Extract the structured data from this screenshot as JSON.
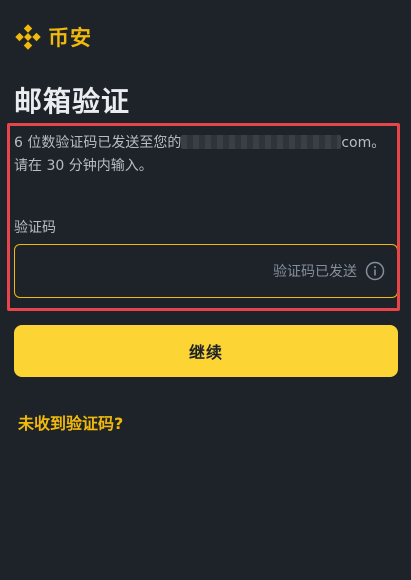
{
  "brand": {
    "name": "币安",
    "color": "#f0b90b"
  },
  "title": "邮箱验证",
  "description": {
    "line1_prefix": "6 位数验证码已发送至您的",
    "line1_suffix": "com。",
    "line2": "请在 30 分钟内输入。"
  },
  "code_field": {
    "label": "验证码",
    "value": "",
    "placeholder": "",
    "status_text": "验证码已发送",
    "icon": "info-icon"
  },
  "continue_button": {
    "label": "继续",
    "color": "#fcd535"
  },
  "resend_link": {
    "label": "未收到验证码?"
  },
  "highlight_color": "#e8454b",
  "background_color": "#1e2329"
}
